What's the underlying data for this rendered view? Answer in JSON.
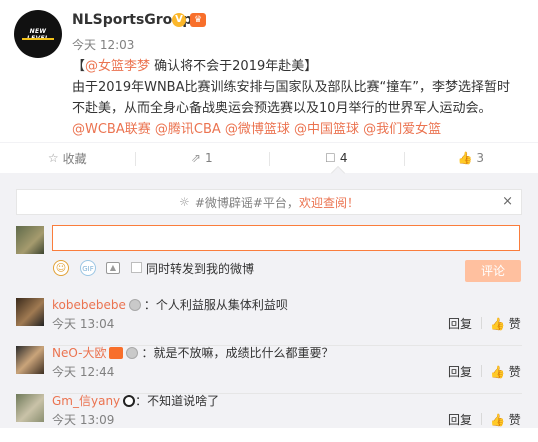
{
  "post": {
    "username": "NLSportsGroup",
    "avatar_text": "NEW LEVEL",
    "verified_icon": "verified-v-icon",
    "vip_icon": "vip-badge-icon",
    "time": "今天 12:03",
    "title_open": "【",
    "mention": "@女篮李梦",
    "title_rest": " 确认将不会于2019年赴美】",
    "body": "由于2019年WNBA比赛训练安排与国家队及部队比赛“撞车”，李梦选择暂时不赴美，从而全身心备战奥运会预选赛以及10月举行的世界军人运动会。",
    "tags": "@WCBA联赛 @腾讯CBA @微博篮球 @中国篮球 @我们爱女篮"
  },
  "actions": [
    {
      "icon": "star-icon",
      "glyph": "☆",
      "label": "收藏"
    },
    {
      "icon": "forward-icon",
      "glyph": "⇗",
      "label": "1"
    },
    {
      "icon": "comment-icon",
      "glyph": "☐",
      "label": "4"
    },
    {
      "icon": "like-icon",
      "glyph": "👍",
      "label": "3"
    }
  ],
  "comment_area": {
    "notice_prefix": "#微博辟谣#平台，",
    "notice_highlight": "欢迎查阅！",
    "notice_close": "×",
    "input_value": "",
    "repost_label": "同时转发到我的微博",
    "submit_label": "评论",
    "icons": {
      "emoji": "smile-icon",
      "gif": "gif-icon",
      "image": "image-icon"
    }
  },
  "comments": [
    {
      "name": "kobebebebe",
      "text": "：个人利益服从集体利益呗",
      "time": "今天 13:04",
      "reply": "回复",
      "like": "赞",
      "has_vip": false,
      "has_panda": false
    },
    {
      "name": "NeO-大欧",
      "text": "：就是不放嘛，成绩比什么都重要？",
      "time": "今天 12:44",
      "reply": "回复",
      "like": "赞",
      "has_vip": true,
      "has_panda": false
    },
    {
      "name": "Gm_信yany",
      "text": "：不知道说啥了",
      "time": "今天 13:09",
      "reply": "回复",
      "like": "赞",
      "has_vip": false,
      "has_panda": true
    }
  ],
  "colors": {
    "accent": "#eb7350",
    "input_border": "#fa7d3c",
    "submit_disabled": "#ffc09f",
    "panel_bg": "#f2f2f5"
  }
}
